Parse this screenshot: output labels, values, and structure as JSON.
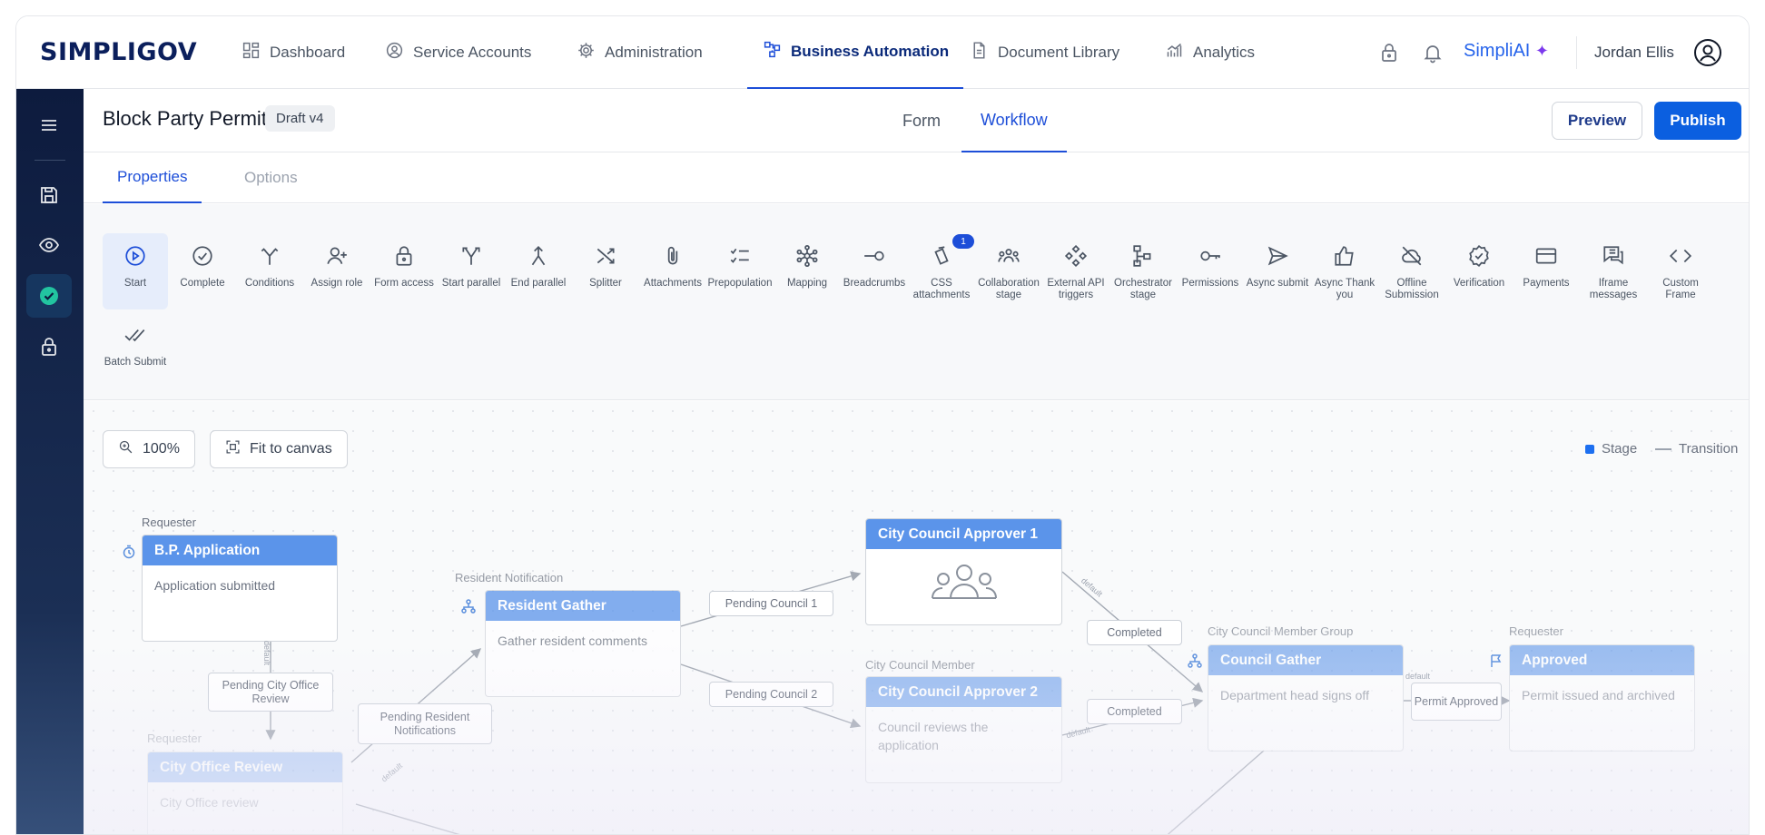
{
  "brand": {
    "logo_text": "SIMPLIGOV"
  },
  "nav": {
    "items": [
      {
        "label": "Dashboard",
        "icon": "grid-icon"
      },
      {
        "label": "Service Accounts",
        "icon": "user-circle-icon"
      },
      {
        "label": "Administration",
        "icon": "gear-icon"
      },
      {
        "label": "Business Automation",
        "icon": "flow-icon",
        "active": true
      },
      {
        "label": "Document Library",
        "icon": "document-icon"
      },
      {
        "label": "Analytics",
        "icon": "analytics-icon"
      }
    ],
    "simpliai": "SimpliAI",
    "user_name": "Jordan Ellis"
  },
  "sidebar": {
    "items": [
      {
        "icon": "menu-icon"
      },
      {
        "icon": "save-icon"
      },
      {
        "icon": "eye-icon"
      },
      {
        "icon": "check-circle-icon",
        "active": true
      },
      {
        "icon": "lock-icon"
      }
    ]
  },
  "form": {
    "title": "Block Party Permit",
    "badge": "Draft v4",
    "tabs": [
      "Form",
      "Workflow"
    ],
    "active_tab": "Workflow",
    "preview_label": "Preview",
    "publish_label": "Publish"
  },
  "properties": {
    "tabs": [
      "Properties",
      "Options"
    ],
    "active_tab": "Properties"
  },
  "tools": [
    {
      "label": "Start",
      "icon": "play-circle-icon",
      "active": true
    },
    {
      "label": "Complete",
      "icon": "check-circle-icon"
    },
    {
      "label": "Conditions",
      "icon": "branch-icon"
    },
    {
      "label": "Assign role",
      "icon": "user-plus-icon"
    },
    {
      "label": "Form access",
      "icon": "lock-icon"
    },
    {
      "label": "Start parallel",
      "icon": "split-arrows-icon"
    },
    {
      "label": "End parallel",
      "icon": "merge-arrows-icon"
    },
    {
      "label": "Splitter",
      "icon": "shuffle-icon"
    },
    {
      "label": "Attachments",
      "icon": "paperclip-icon"
    },
    {
      "label": "Prepopulation",
      "icon": "checklist-icon"
    },
    {
      "label": "Mapping",
      "icon": "network-icon"
    },
    {
      "label": "Breadcrumbs",
      "icon": "breadcrumb-icon"
    },
    {
      "label": "CSS attachments",
      "icon": "css-files-icon",
      "badge": "1"
    },
    {
      "label": "Collaboration stage",
      "icon": "group-icon"
    },
    {
      "label": "External API triggers",
      "icon": "api-diamond-icon"
    },
    {
      "label": "Orchestrator stage",
      "icon": "orchestrator-icon"
    },
    {
      "label": "Permissions",
      "icon": "key-icon"
    },
    {
      "label": "Async submit",
      "icon": "send-icon"
    },
    {
      "label": "Async Thank you",
      "icon": "thumbs-up-icon"
    },
    {
      "label": "Offline Submission",
      "icon": "cloud-off-icon"
    },
    {
      "label": "Verification",
      "icon": "badge-check-icon"
    },
    {
      "label": "Payments",
      "icon": "credit-card-icon"
    },
    {
      "label": "Iframe messages",
      "icon": "messages-icon"
    },
    {
      "label": "Custom Frame",
      "icon": "code-icon"
    },
    {
      "label": "Batch Submit",
      "icon": "double-check-icon"
    }
  ],
  "canvas": {
    "zoom": "100%",
    "fit_label": "Fit to canvas",
    "legend": {
      "stage": "Stage",
      "transition": "Transition"
    },
    "nodes": [
      {
        "id": "bp",
        "role": "Requester",
        "title": "B.P. Application",
        "body": "Application submitted"
      },
      {
        "id": "rg",
        "role": "Resident Notification",
        "title": "Resident Gather",
        "body": "Gather resident comments"
      },
      {
        "id": "ca1",
        "role": "",
        "title": "City Council Approver 1",
        "body": ""
      },
      {
        "id": "ca2",
        "role": "City Council Member",
        "title": "City Council Approver 2",
        "body": "Council reviews the application"
      },
      {
        "id": "cg",
        "role": "City Council Member Group",
        "title": "Council Gather",
        "body": "Department head signs off"
      },
      {
        "id": "ap",
        "role": "Requester",
        "title": "Approved",
        "body": "Permit issued and archived"
      },
      {
        "id": "cor",
        "role": "Requester",
        "title": "City Office Review",
        "body": "City Office review"
      }
    ],
    "transitions": [
      {
        "label": "Pending City Office Review"
      },
      {
        "label": "Pending Resident Notifications"
      },
      {
        "label": "Pending Council 1"
      },
      {
        "label": "Pending Council 2"
      },
      {
        "label": "Completed"
      },
      {
        "label": "Completed"
      },
      {
        "label": "Permit Approved"
      }
    ],
    "default_label": "default"
  }
}
